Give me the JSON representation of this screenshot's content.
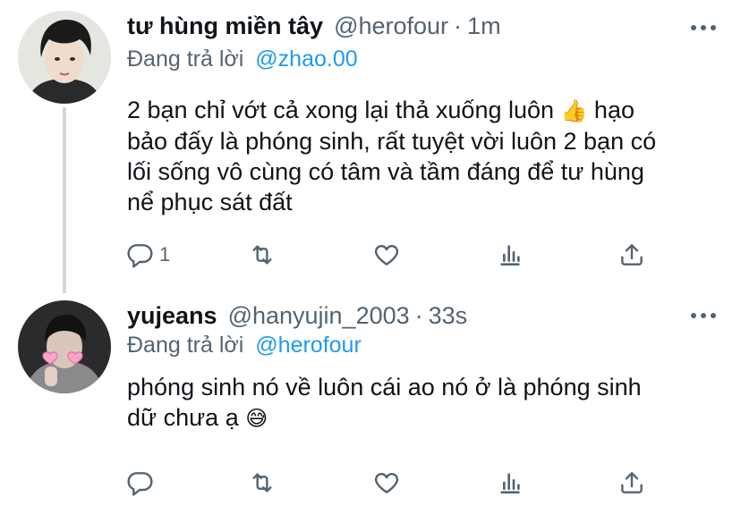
{
  "tweets": [
    {
      "display_name": "tư hùng miền tây",
      "handle": "@herofour",
      "separator": "·",
      "time": "1m",
      "reply_prefix": "Đang trả lời",
      "reply_to": "@zhao.00",
      "text_part1": "2 bạn chỉ vớt cả xong lại thả xuống luôn ",
      "emoji1": "👍",
      "text_part2": "  hạo\nbảo đấy là phóng sinh, rất tuyệt vời luôn 2 bạn có\nlối sống vô cùng có tâm và tầm đáng để tư hùng\nnể phục sát đất",
      "reply_count": "1",
      "avatar_icon": "user-avatar-photo"
    },
    {
      "display_name": "yujeans",
      "handle": "@hanyujin_2003",
      "separator": "·",
      "time": "33s",
      "reply_prefix": "Đang trả lời",
      "reply_to": "@herofour",
      "text_part1": "phóng sinh nó về luôn cái ao nó ở là phóng sinh\ndữ chưa ạ ",
      "emoji1": "😅",
      "reply_count": "",
      "avatar_icon": "user-avatar-photo-hearts"
    }
  ],
  "colors": {
    "link": "#1d9bf0",
    "secondary": "#536471",
    "thread_line": "#cfd9de"
  },
  "icons": [
    "reply-icon",
    "retweet-icon",
    "like-icon",
    "analytics-icon",
    "share-icon",
    "more-icon"
  ]
}
